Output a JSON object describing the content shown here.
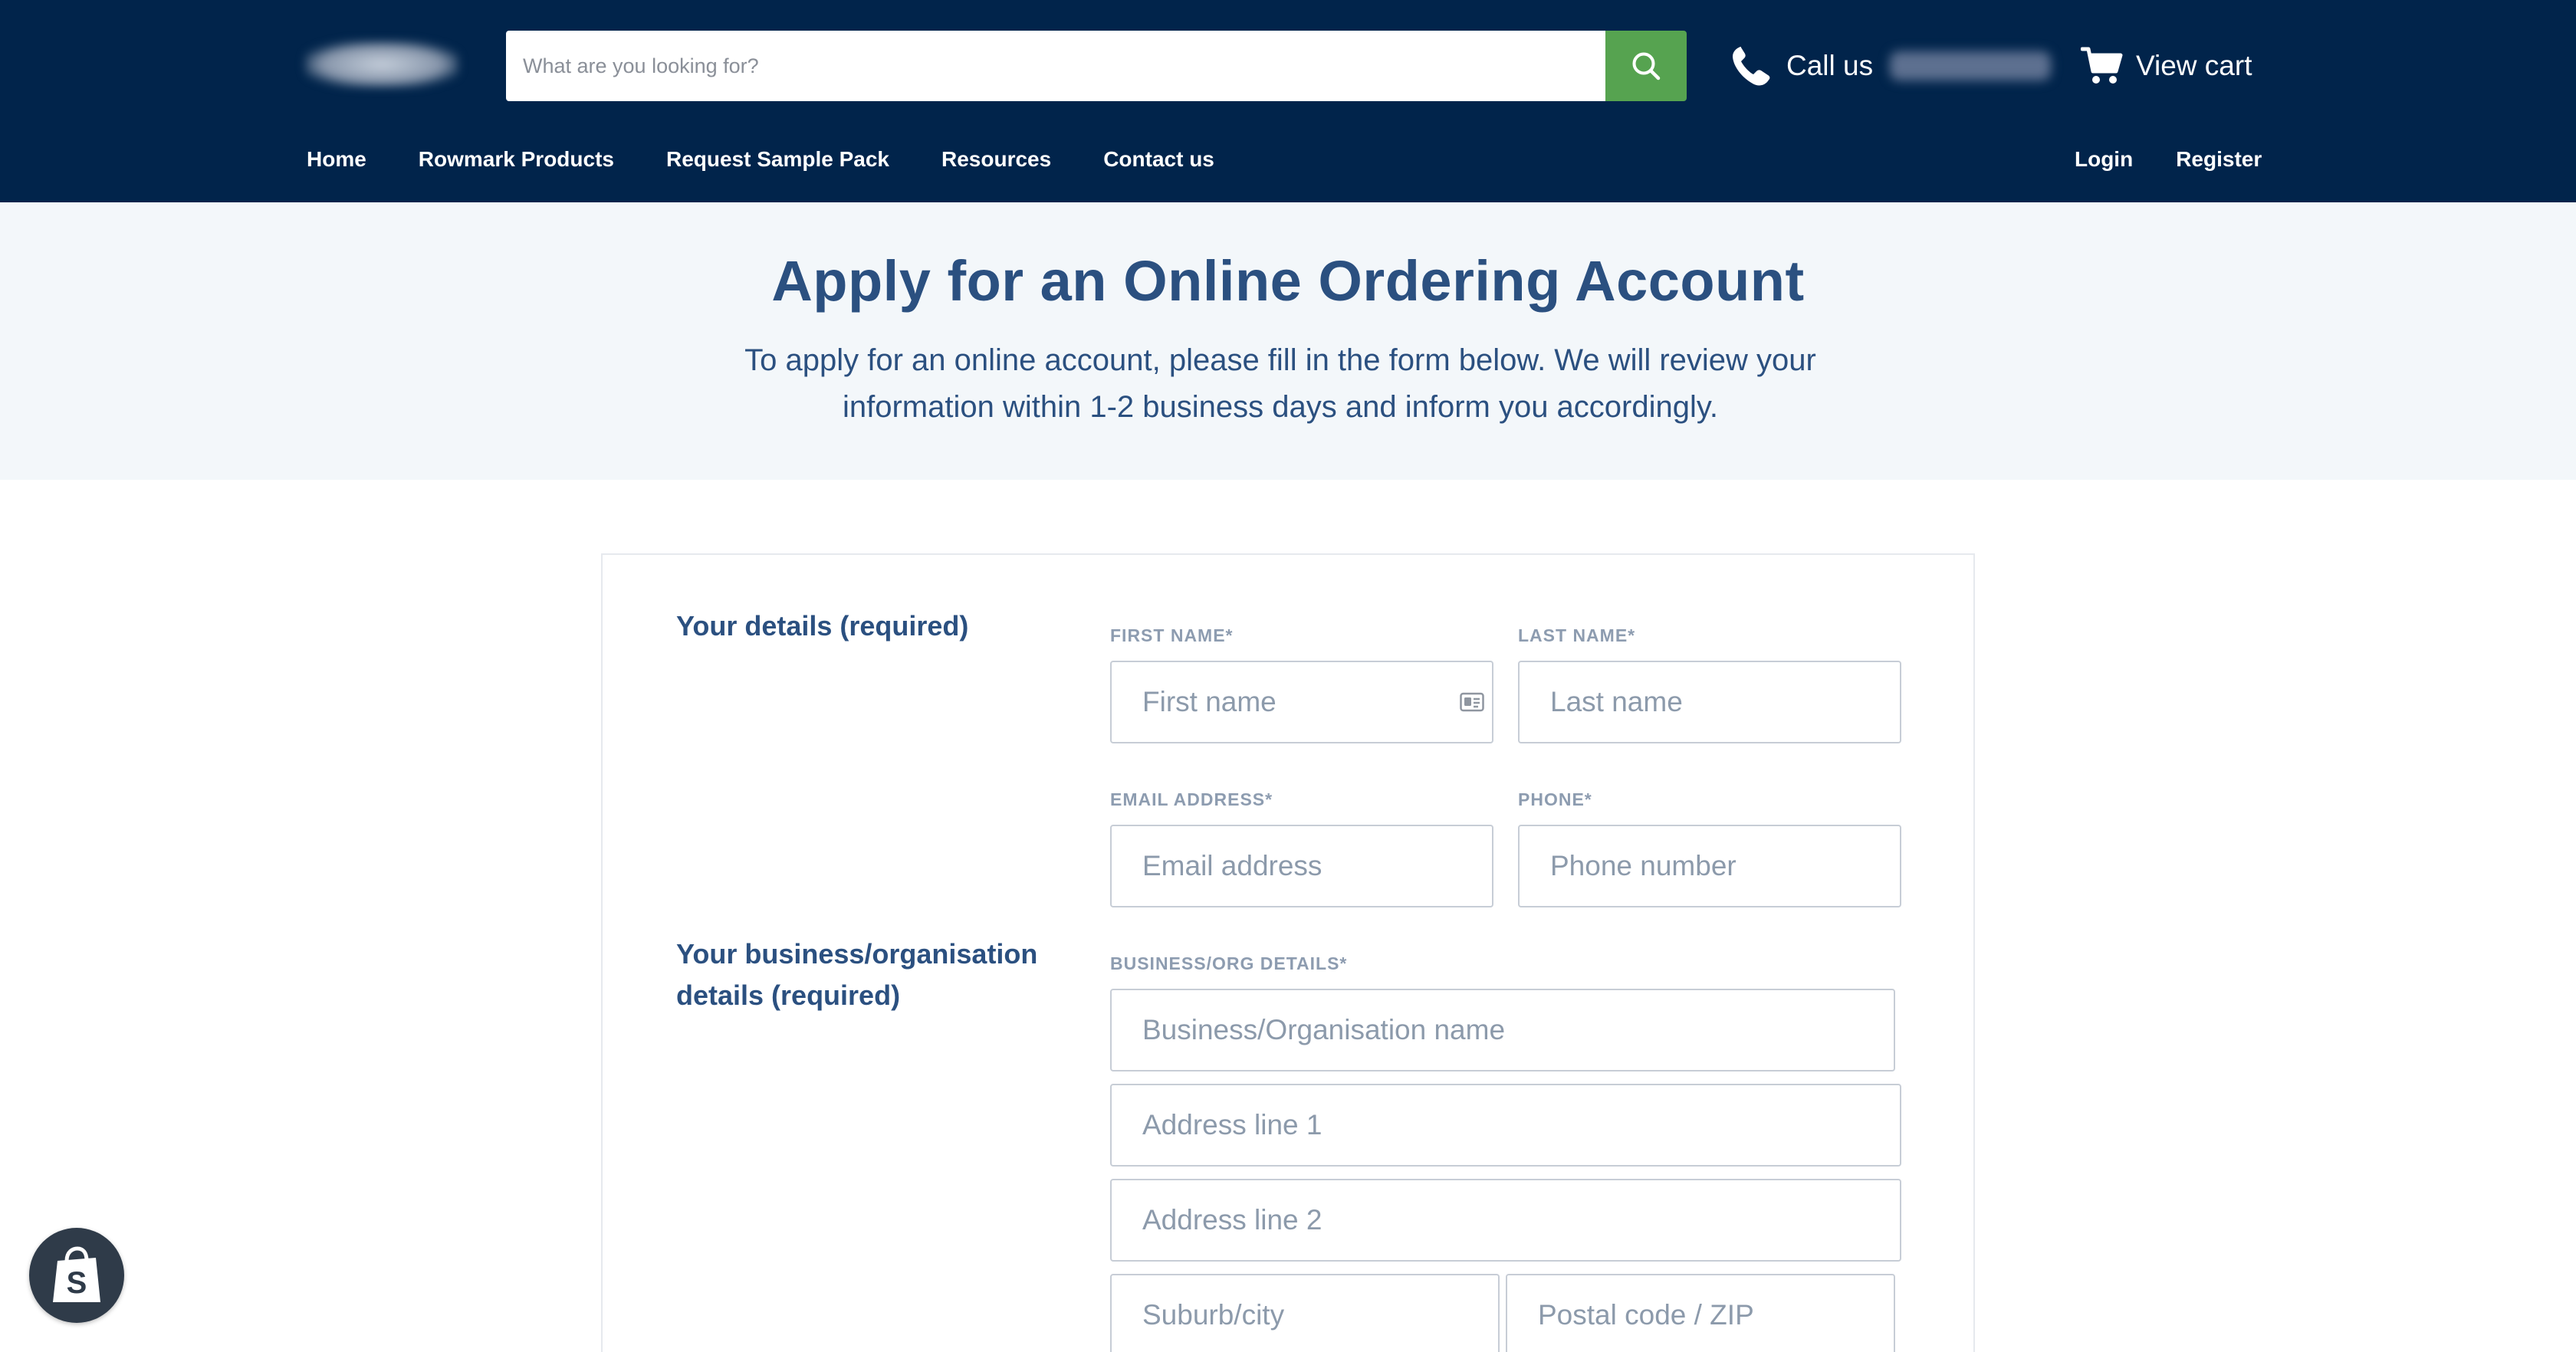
{
  "header": {
    "search": {
      "placeholder": "What are you looking for?"
    },
    "call_label": "Call us",
    "cart_label": "View cart",
    "nav_left": [
      "Home",
      "Rowmark Products",
      "Request Sample Pack",
      "Resources",
      "Contact us"
    ],
    "nav_right": [
      "Login",
      "Register"
    ]
  },
  "hero": {
    "title": "Apply for an Online Ordering Account",
    "description": "To apply for an online account, please fill in the form below. We will review your information within 1-2 business days and inform you accordingly."
  },
  "form": {
    "your_details": {
      "title": "Your details (required)",
      "first_name": {
        "label": "FIRST NAME*",
        "placeholder": "First name"
      },
      "last_name": {
        "label": "LAST NAME*",
        "placeholder": "Last name"
      },
      "email": {
        "label": "EMAIL ADDRESS*",
        "placeholder": "Email address"
      },
      "phone": {
        "label": "PHONE*",
        "placeholder": "Phone number"
      }
    },
    "business": {
      "title_line1": "Your business/organisation",
      "title_line2": "details (required)",
      "label": "BUSINESS/ORG DETAILS*",
      "org_name": "Business/Organisation name",
      "address1": "Address line 1",
      "address2": "Address line 2",
      "city": "Suburb/city",
      "postal": "Postal code / ZIP"
    }
  },
  "colors": {
    "header_bg": "#01244b",
    "accent_green": "#56a350",
    "heading_blue": "#2b5080",
    "hero_bg": "#f3f7fa"
  },
  "icons": [
    "search-icon",
    "phone-icon",
    "cart-icon",
    "contact-card-icon",
    "shopify-bag-icon"
  ]
}
